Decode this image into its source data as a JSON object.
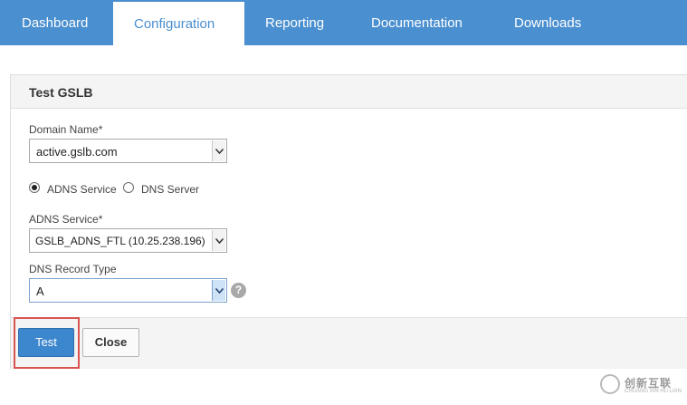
{
  "nav": {
    "tabs": [
      {
        "label": "Dashboard",
        "active": false
      },
      {
        "label": "Configuration",
        "active": true
      },
      {
        "label": "Reporting",
        "active": false
      },
      {
        "label": "Documentation",
        "active": false
      },
      {
        "label": "Downloads",
        "active": false
      }
    ]
  },
  "dialog": {
    "title": "Test GSLB",
    "domain": {
      "label": "Domain Name*",
      "value": "active.gslb.com"
    },
    "source": {
      "options": [
        {
          "label": "ADNS Service",
          "selected": true
        },
        {
          "label": "DNS Server",
          "selected": false
        }
      ]
    },
    "adns": {
      "label": "ADNS Service*",
      "value": "GSLB_ADNS_FTL (10.25.238.196)"
    },
    "record_type": {
      "label": "DNS Record Type",
      "value": "A",
      "help": "?"
    },
    "buttons": {
      "test": "Test",
      "close": "Close"
    }
  },
  "watermark": {
    "text": "创新互联",
    "sub": "CHUANG XIN HU LIAN"
  },
  "colors": {
    "nav_bg": "#4a8fcf",
    "primary_button": "#3d87cf",
    "highlight": "#d9534f"
  }
}
